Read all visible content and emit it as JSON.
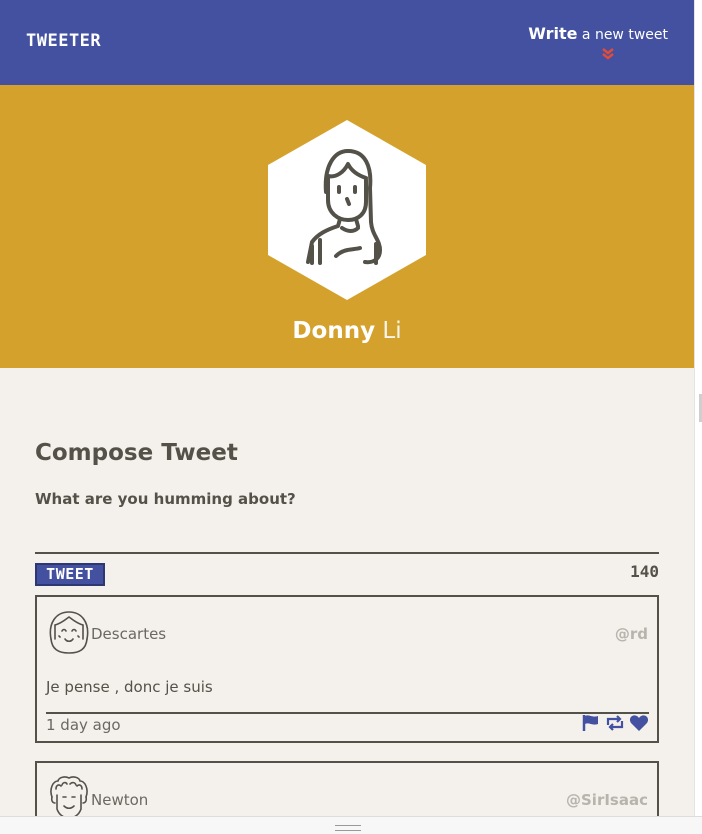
{
  "nav": {
    "brand": "TWEETER",
    "write_bold": "Write",
    "write_rest": " a new tweet",
    "icons": {
      "arrow": "double-chevron-down-icon"
    },
    "colors": {
      "background": "#4351a0",
      "arrow": "#e04b3a"
    }
  },
  "profile": {
    "first_name": "Donny",
    "last_name": " Li",
    "icons": {
      "avatar": "girl-avatar-icon"
    },
    "colors": {
      "background": "#d4a22c"
    }
  },
  "compose": {
    "title": "Compose Tweet",
    "prompt": "What are you humming about?",
    "tweet_button": "TWEET",
    "counter": "140"
  },
  "tweets": [
    {
      "name": "Descartes",
      "handle": "@rd",
      "text": "Je pense , donc je suis",
      "time": "1 day ago",
      "icons": {
        "avatar": "descartes-avatar-icon",
        "flag": "flag-icon",
        "retweet": "retweet-icon",
        "like": "heart-icon"
      }
    },
    {
      "name": "Newton",
      "handle": "@SirIsaac",
      "icons": {
        "avatar": "newton-avatar-icon"
      }
    }
  ],
  "colors": {
    "accent": "#4351a0",
    "page": "#f4f1ec",
    "text": "#545149"
  }
}
